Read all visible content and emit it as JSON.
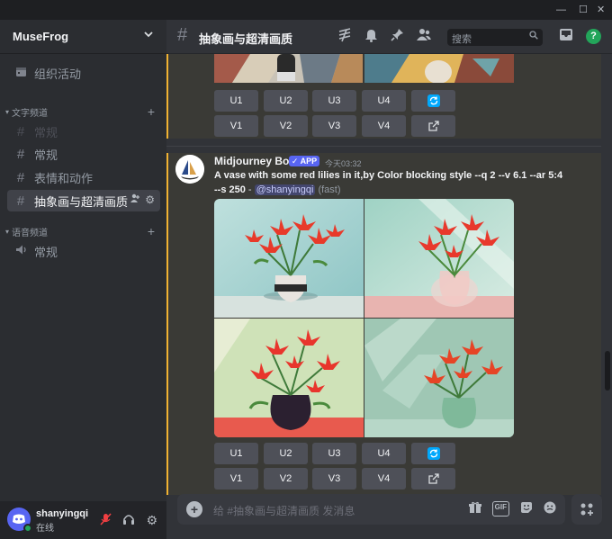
{
  "window": {
    "minimize_glyph": "—",
    "maximize_glyph": "☐",
    "close_glyph": "✕"
  },
  "server": {
    "name": "MuseFrog",
    "menu_icon": "chevron-down-icon"
  },
  "sidebar": {
    "event_item": "组织活动",
    "text_category": "文字频道",
    "voice_category": "语音频道",
    "text_channels": [
      {
        "label": "常规",
        "state": "dim"
      },
      {
        "label": "常规",
        "state": "normal"
      },
      {
        "label": "表情和动作",
        "state": "normal"
      },
      {
        "label": "抽象画与超清画质",
        "state": "active"
      }
    ],
    "voice_channels": [
      {
        "label": "常规"
      }
    ]
  },
  "user": {
    "name": "shanyingqi",
    "status": "在线"
  },
  "channel": {
    "name": "抽象画与超清画质",
    "search_placeholder": "搜索"
  },
  "messages": [
    {
      "author": "",
      "buttons_row1": [
        "U1",
        "U2",
        "U3",
        "U4"
      ],
      "buttons_row2": [
        "V1",
        "V2",
        "V3",
        "V4"
      ]
    },
    {
      "author": "Midjourney Bot",
      "badge": "✓ APP",
      "timestamp": "今天03:32",
      "prompt_bold": "A vase with some red lilies in it,by Color blocking style --q 2 --v 6.1 --ar 5:4 --s 250",
      "prompt_sep": " - ",
      "mention": "@shanyingqi",
      "mode": " (fast)",
      "buttons_row1": [
        "U1",
        "U2",
        "U3",
        "U4"
      ],
      "buttons_row2": [
        "V1",
        "V2",
        "V3",
        "V4"
      ]
    }
  ],
  "composer": {
    "placeholder": "给 #抽象画与超清画质 发消息",
    "gif_label": "GIF"
  },
  "colors": {
    "accent": "#5865f2",
    "online": "#23a55a",
    "highlight_bar": "#f0b232",
    "refresh": "#00a8fc"
  }
}
